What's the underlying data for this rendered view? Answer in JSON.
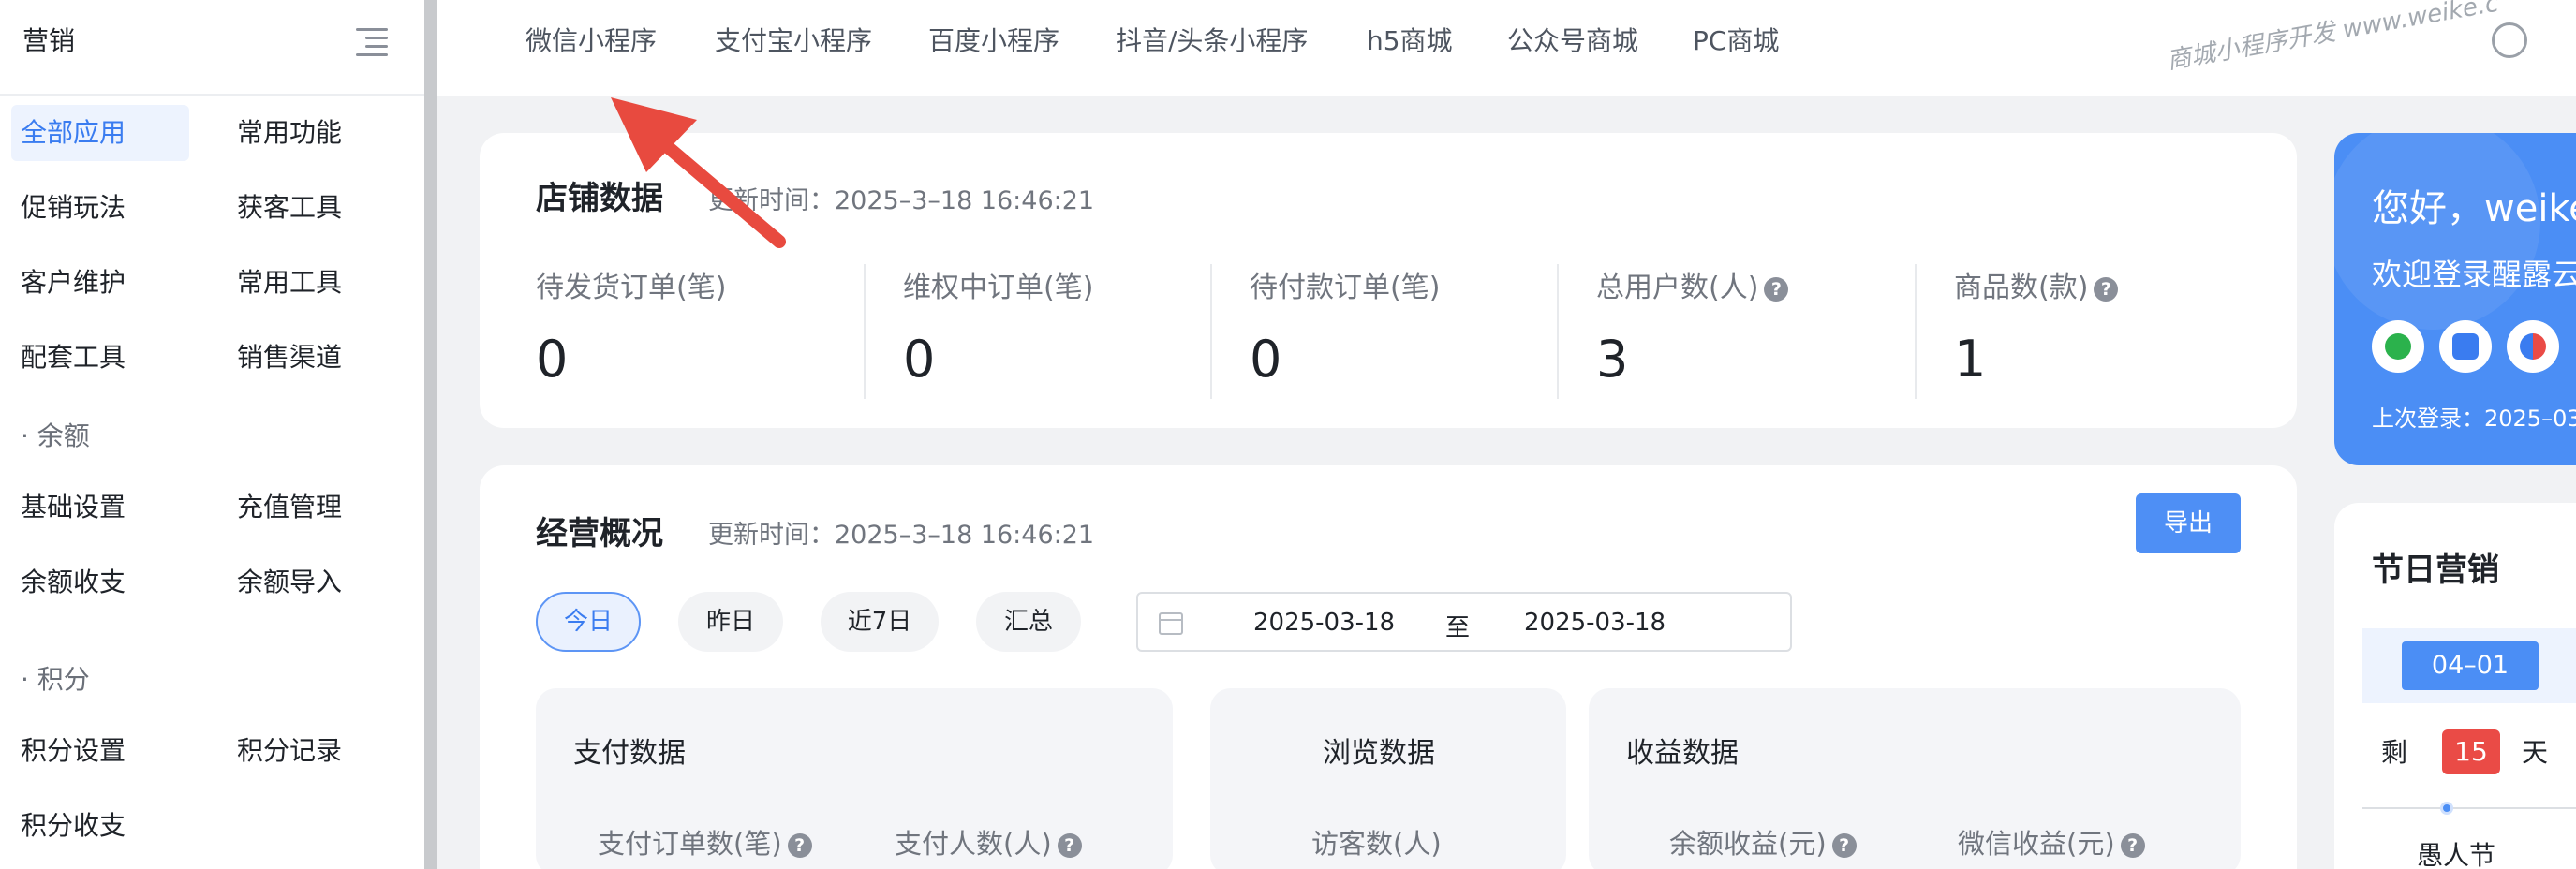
{
  "sidebar": {
    "title": "营销",
    "menu_icon": "hamburger-icon",
    "col1": [
      "全部应用",
      "促销玩法",
      "客户维护",
      "配套工具"
    ],
    "col2": [
      "常用功能",
      "获客工具",
      "常用工具",
      "销售渠道"
    ],
    "balance_section": "· 余额",
    "balance_items": [
      "基础设置",
      "充值管理",
      "余额收支",
      "余额导入"
    ],
    "points_section": "· 积分",
    "points_items": [
      "积分设置",
      "积分记录",
      "积分收支"
    ],
    "active_item": "全部应用"
  },
  "topnav": {
    "tabs": [
      "微信小程序",
      "支付宝小程序",
      "百度小程序",
      "抖音/头条小程序",
      "h5商城",
      "公众号商城",
      "PC商城"
    ],
    "watermark": "商城小程序开发  www.weike.c"
  },
  "store_data": {
    "title": "店铺数据",
    "update_time": "更新时间：2025–3–18 16:46:21",
    "stats": [
      {
        "label": "待发货订单(笔)",
        "value": "0",
        "help": false
      },
      {
        "label": "维权中订单(笔)",
        "value": "0",
        "help": false
      },
      {
        "label": "待付款订单(笔)",
        "value": "0",
        "help": false
      },
      {
        "label": "总用户数(人)",
        "value": "3",
        "help": true
      },
      {
        "label": "商品数(款)",
        "value": "1",
        "help": true
      }
    ]
  },
  "business": {
    "title": "经营概况",
    "update_time": "更新时间：2025–3–18 16:46:21",
    "export_label": "导出",
    "ranges": [
      "今日",
      "昨日",
      "近7日",
      "汇总"
    ],
    "active_range": "今日",
    "date_start": "2025-03-18",
    "date_sep": "至",
    "date_end": "2025-03-18",
    "pay": {
      "title": "支付数据",
      "labels": [
        "支付订单数(笔)",
        "支付人数(人)"
      ]
    },
    "browse": {
      "title": "浏览数据",
      "labels": [
        "访客数(人)"
      ]
    },
    "income": {
      "title": "收益数据",
      "labels": [
        "余额收益(元)",
        "微信收益(元)"
      ]
    }
  },
  "welcome": {
    "hello": "您好，weike",
    "welcome_text": "欢迎登录醒露云",
    "last_login": "上次登录：2025–03",
    "icons": [
      "link-icon",
      "cube-icon",
      "brand-icon"
    ]
  },
  "festival": {
    "title": "节日营销",
    "date": "04–01",
    "remain_prefix": "剩",
    "remain_days": "15",
    "remain_suffix": "天",
    "name": "愚人节"
  },
  "colors": {
    "accent": "#4b8ef5",
    "danger": "#ea4b46",
    "active_bg": "#edf3fe"
  }
}
